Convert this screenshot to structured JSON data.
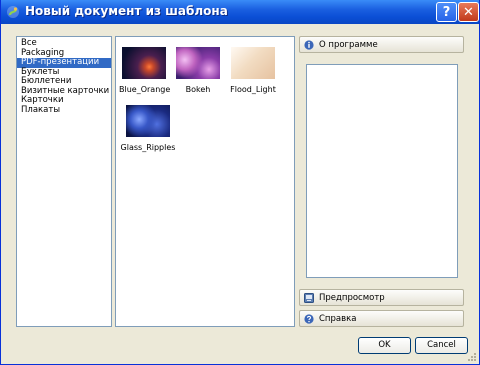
{
  "window": {
    "title": "Новый документ из шаблона"
  },
  "titlebar": {
    "help_glyph": "?",
    "close_glyph": "✕"
  },
  "categories": [
    {
      "label": "Все",
      "selected": false
    },
    {
      "label": "Packaging",
      "selected": false
    },
    {
      "label": "PDF-презентации",
      "selected": true
    },
    {
      "label": "Буклеты",
      "selected": false
    },
    {
      "label": "Бюллетени",
      "selected": false
    },
    {
      "label": "Визитные карточки",
      "selected": false
    },
    {
      "label": "Карточки",
      "selected": false
    },
    {
      "label": "Плакаты",
      "selected": false
    }
  ],
  "templates": [
    {
      "label": "Blue_Orange",
      "colors": [
        "#0a0f2e",
        "#5a2a5a",
        "#e0602a"
      ]
    },
    {
      "label": "Bokeh",
      "colors": [
        "#3a1e6e",
        "#b04cb0",
        "#e8a0e8"
      ]
    },
    {
      "label": "Flood_Light",
      "colors": [
        "#f6e8d8",
        "#e8c8a8",
        "#fff7ee"
      ]
    },
    {
      "label": "Glass_Ripples",
      "colors": [
        "#0a1240",
        "#2040a0",
        "#6a8cf0"
      ]
    }
  ],
  "side": {
    "about_label": "О программе",
    "preview_label": "Предпросмотр",
    "help_label": "Справка"
  },
  "buttons": {
    "ok": "OK",
    "cancel": "Cancel"
  },
  "colors": {
    "titlebar": "#0b4fd6",
    "selection": "#316ac5",
    "dialog_bg": "#ece9d8"
  }
}
